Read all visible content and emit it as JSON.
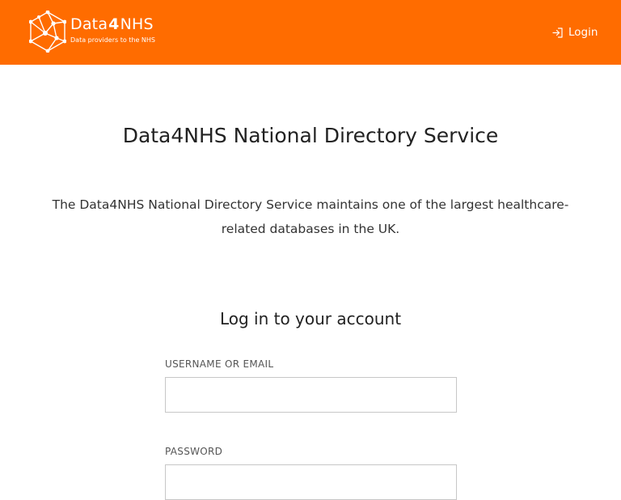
{
  "header": {
    "brand": {
      "name_prefix": "Data",
      "name_number": "4",
      "name_suffix": "NHS",
      "tagline": "Data providers to the NHS"
    },
    "login_label": "Login",
    "login_icon": "login-icon",
    "background_color": "#ff6c00"
  },
  "main": {
    "title": "Data4NHS National Directory Service",
    "intro": "The Data4NHS National Directory Service maintains one of the largest healthcare-related databases in the UK."
  },
  "login_form": {
    "title": "Log in to your account",
    "username_label": "USERNAME OR EMAIL",
    "username_value": "",
    "password_label": "PASSWORD",
    "password_value": ""
  }
}
